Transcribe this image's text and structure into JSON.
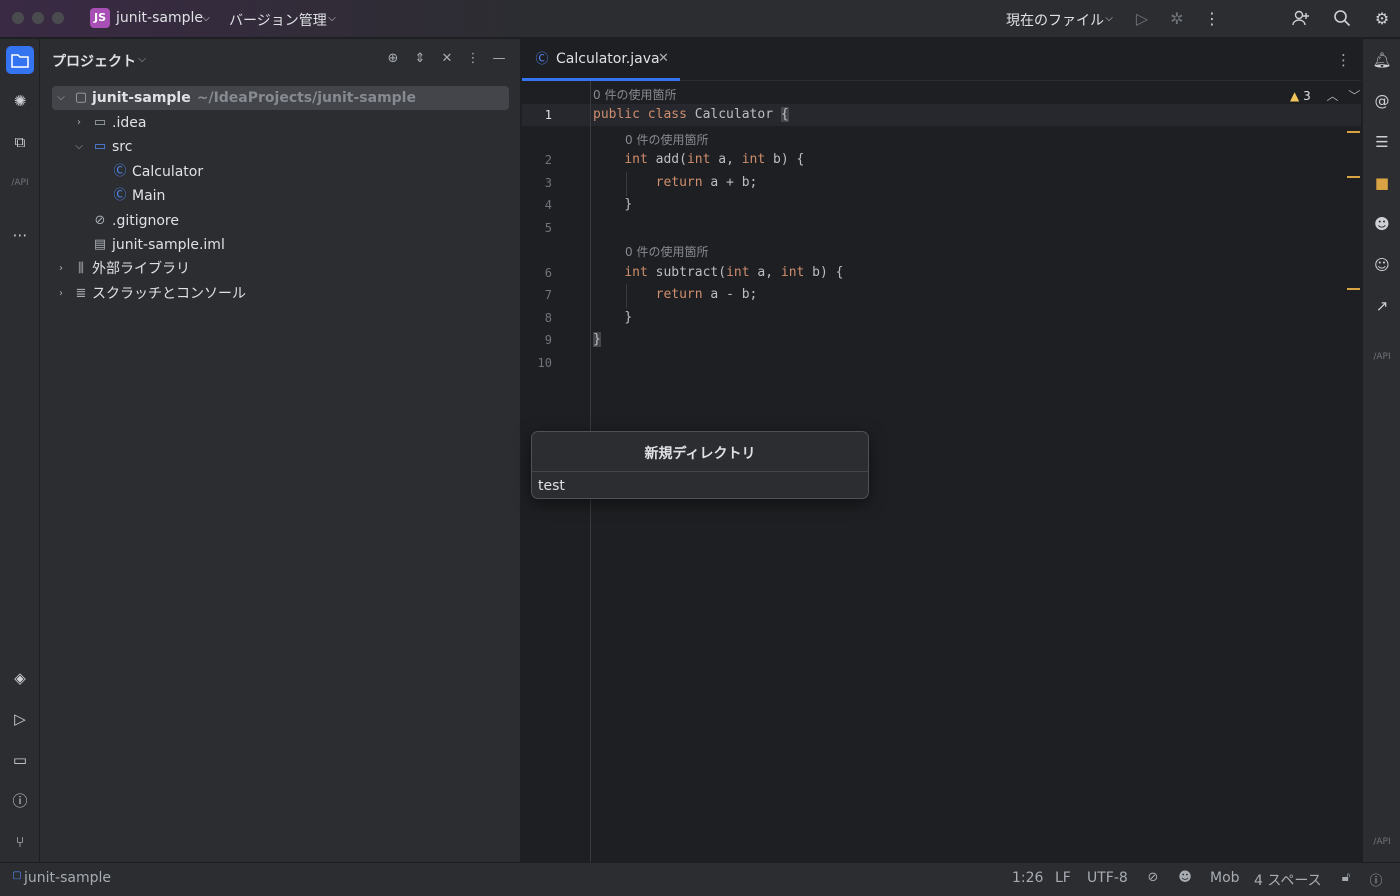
{
  "titlebar": {
    "project_badge": "JS",
    "project_name": "junit-sample",
    "vcs_menu": "バージョン管理",
    "run_config": "現在のファイル"
  },
  "project_panel": {
    "title": "プロジェクト",
    "tree": [
      {
        "label": "junit-sample",
        "path": "~/IdeaProjects/junit-sample",
        "kind": "module-folder",
        "expanded": true,
        "selected": true
      },
      {
        "label": ".idea",
        "kind": "folder",
        "expanded": false
      },
      {
        "label": "src",
        "kind": "source-folder",
        "expanded": true
      },
      {
        "label": "Calculator",
        "kind": "class"
      },
      {
        "label": "Main",
        "kind": "class"
      },
      {
        "label": ".gitignore",
        "kind": "ignore-file"
      },
      {
        "label": "junit-sample.iml",
        "kind": "iml-file"
      },
      {
        "label": "外部ライブラリ",
        "kind": "libraries",
        "expanded": false
      },
      {
        "label": "スクラッチとコンソール",
        "kind": "scratches",
        "expanded": false
      }
    ]
  },
  "editor": {
    "tab_label": "Calculator.java",
    "usage_hint": "0 件の使用箇所",
    "warning_count": "3",
    "line_numbers": [
      "1",
      "2",
      "3",
      "4",
      "5",
      "6",
      "7",
      "8",
      "9",
      "10"
    ],
    "code": {
      "l1_kw": "public class",
      "l1_name": "Calculator",
      "l1_brace": "{",
      "l2_type": "int",
      "l2_name": "add",
      "l2_open": "(",
      "l2_t1": "int",
      "l2_p1": " a, ",
      "l2_t2": "int",
      "l2_p2": " b) {",
      "l3_kw": "return",
      "l3_expr": " a + b;",
      "l4": "}",
      "l6_type": "int",
      "l6_name": "subtract",
      "l6_open": "(",
      "l6_t1": "int",
      "l6_p1": " a, ",
      "l6_t2": "int",
      "l6_p2": " b) {",
      "l7_kw": "return",
      "l7_expr": " a - b;",
      "l8": "}",
      "l9": "}"
    }
  },
  "popup": {
    "title": "新規ディレクトリ",
    "value": "test"
  },
  "statusbar": {
    "breadcrumb": "junit-sample",
    "position": "1:26",
    "line_sep": "LF",
    "encoding": "UTF-8",
    "mob": "Mob",
    "indent": "4 スペース"
  }
}
